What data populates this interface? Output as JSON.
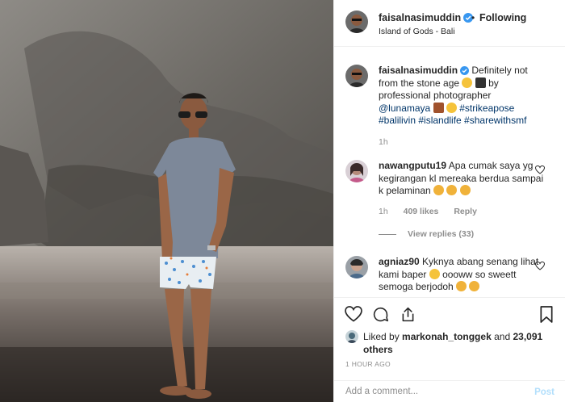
{
  "header": {
    "username": "faisalnasimuddin",
    "separator": "•",
    "follow_label": "Following",
    "location": "Island of Gods - Bali"
  },
  "caption": {
    "username": "faisalnasimuddin",
    "text_1": "Definitely not from the stone age",
    "text_2": "by professional photographer",
    "mention": "@lunamaya",
    "tags_1": "#strikeapose",
    "tags_2": "#balilivin #islandlife #sharewithsmf",
    "time": "1h"
  },
  "comments": [
    {
      "username": "nawangputu19",
      "text": "Apa cumak saya yg kegirangan kl mereaka berdua sampai k pelaminan",
      "time": "1h",
      "likes": "409 likes",
      "reply": "Reply",
      "view_replies": "View replies (33)"
    },
    {
      "username": "agniaz90",
      "text_1": "Kyknya abang senang lihat kami baper",
      "text_2": "oooww so sweett semoga berjodoh"
    }
  ],
  "likes": {
    "prefix": "Liked by",
    "user": "markonah_tonggek",
    "suffix": "and",
    "count": "23,091 others"
  },
  "timestamp": "1 HOUR AGO",
  "add_comment": {
    "placeholder": "Add a comment...",
    "post_label": "Post"
  },
  "icons": {
    "like": "heart-icon",
    "comment": "comment-icon",
    "share": "share-icon",
    "save": "bookmark-icon",
    "verified": "verified-badge-icon"
  },
  "colors": {
    "verified": "#3897f0",
    "link": "#003569",
    "muted": "#8e8e8e",
    "post_disabled": "#b2dffc",
    "emoji_heart_eyes": "#f0b23a",
    "emoji_heart": "#e0245e"
  }
}
